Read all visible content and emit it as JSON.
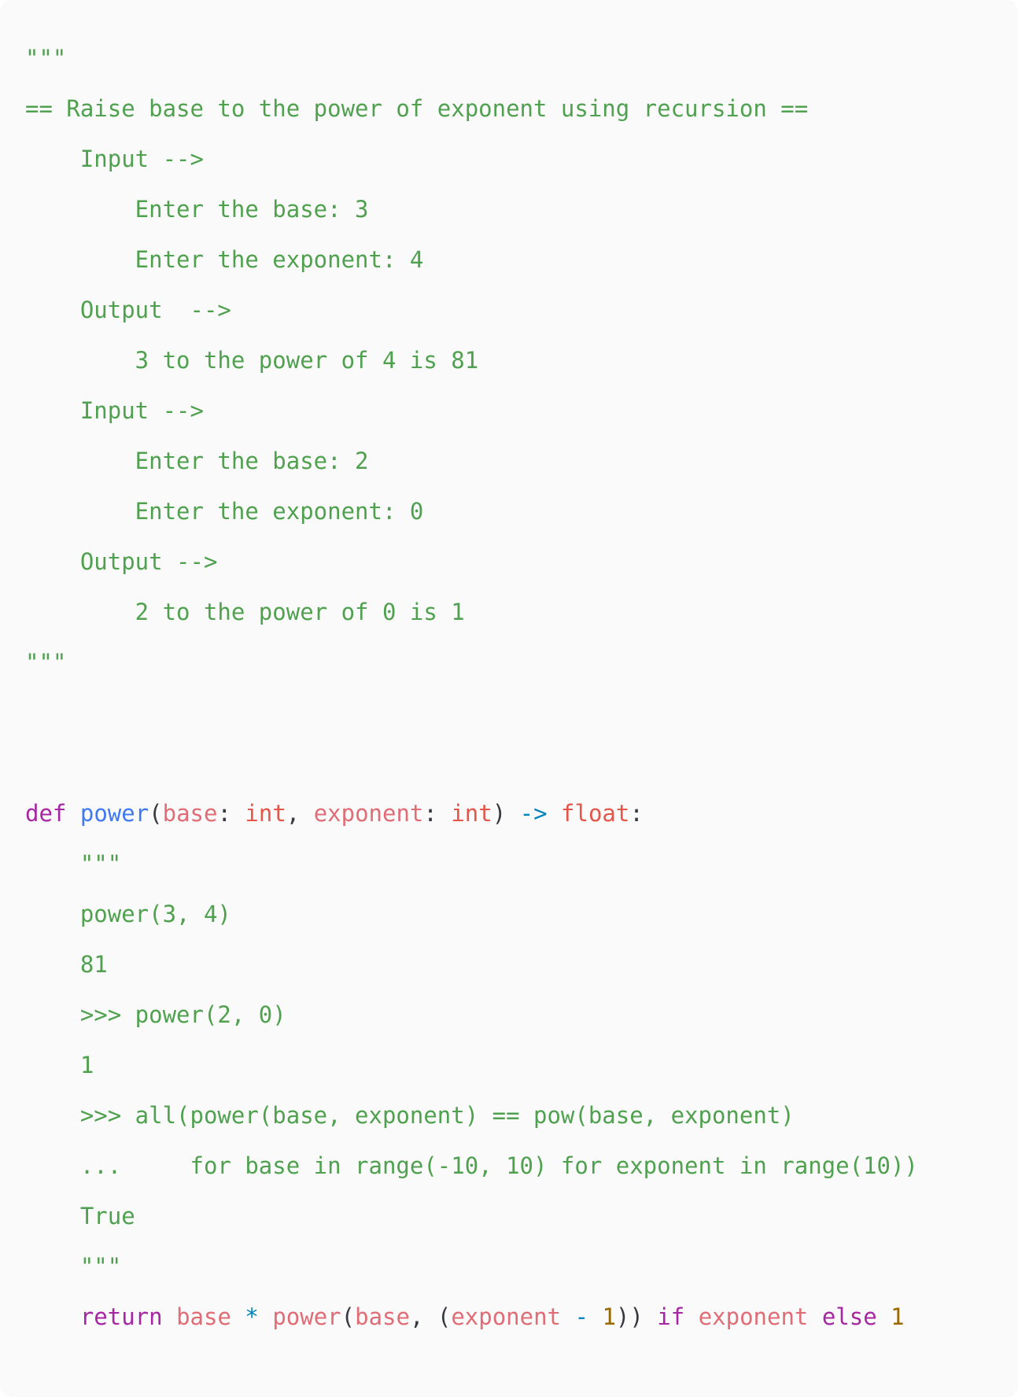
{
  "colors": {
    "background": "#fafafa",
    "string": "#50a14f",
    "keyword": "#a626a4",
    "function": "#4078f2",
    "parameter": "#e45649",
    "variable": "#e06c75",
    "operator": "#0184bc",
    "number": "#986801",
    "punctuation": "#383a42"
  },
  "code": {
    "lines": [
      {
        "tokens": [
          {
            "t": "\"\"\"",
            "k": "str"
          }
        ]
      },
      {
        "tokens": [
          {
            "t": "== Raise base to the power of exponent using recursion ==",
            "k": "str"
          }
        ]
      },
      {
        "tokens": [
          {
            "t": "    Input -->",
            "k": "str"
          }
        ]
      },
      {
        "tokens": [
          {
            "t": "        Enter the base: 3",
            "k": "str"
          }
        ]
      },
      {
        "tokens": [
          {
            "t": "        Enter the exponent: 4",
            "k": "str"
          }
        ]
      },
      {
        "tokens": [
          {
            "t": "    Output  -->",
            "k": "str"
          }
        ]
      },
      {
        "tokens": [
          {
            "t": "        3 to the power of 4 is 81",
            "k": "str"
          }
        ]
      },
      {
        "tokens": [
          {
            "t": "    Input -->",
            "k": "str"
          }
        ]
      },
      {
        "tokens": [
          {
            "t": "        Enter the base: 2",
            "k": "str"
          }
        ]
      },
      {
        "tokens": [
          {
            "t": "        Enter the exponent: 0",
            "k": "str"
          }
        ]
      },
      {
        "tokens": [
          {
            "t": "    Output -->",
            "k": "str"
          }
        ]
      },
      {
        "tokens": [
          {
            "t": "        2 to the power of 0 is 1",
            "k": "str"
          }
        ]
      },
      {
        "tokens": [
          {
            "t": "\"\"\"",
            "k": "str"
          }
        ]
      },
      {
        "tokens": []
      },
      {
        "tokens": []
      },
      {
        "tokens": [
          {
            "t": "def",
            "k": "kw"
          },
          {
            "t": " ",
            "k": "punc"
          },
          {
            "t": "power",
            "k": "fn"
          },
          {
            "t": "(",
            "k": "punc"
          },
          {
            "t": "base",
            "k": "var"
          },
          {
            "t": ": ",
            "k": "punc"
          },
          {
            "t": "int",
            "k": "type"
          },
          {
            "t": ", ",
            "k": "punc"
          },
          {
            "t": "exponent",
            "k": "var"
          },
          {
            "t": ": ",
            "k": "punc"
          },
          {
            "t": "int",
            "k": "type"
          },
          {
            "t": ") ",
            "k": "punc"
          },
          {
            "t": "->",
            "k": "op"
          },
          {
            "t": " ",
            "k": "punc"
          },
          {
            "t": "float",
            "k": "type"
          },
          {
            "t": ":",
            "k": "punc"
          }
        ]
      },
      {
        "tokens": [
          {
            "t": "    \"\"\"",
            "k": "str"
          }
        ]
      },
      {
        "tokens": [
          {
            "t": "    power(3, 4)",
            "k": "str"
          }
        ]
      },
      {
        "tokens": [
          {
            "t": "    81",
            "k": "str"
          }
        ]
      },
      {
        "tokens": [
          {
            "t": "    >>> power(2, 0)",
            "k": "str"
          }
        ]
      },
      {
        "tokens": [
          {
            "t": "    1",
            "k": "str"
          }
        ]
      },
      {
        "tokens": [
          {
            "t": "    >>> all(power(base, exponent) == pow(base, exponent)",
            "k": "str"
          }
        ]
      },
      {
        "tokens": [
          {
            "t": "    ...     for base in range(-10, 10) for exponent in range(10))",
            "k": "str"
          }
        ]
      },
      {
        "tokens": [
          {
            "t": "    True",
            "k": "str"
          }
        ]
      },
      {
        "tokens": [
          {
            "t": "    \"\"\"",
            "k": "str"
          }
        ]
      },
      {
        "tokens": [
          {
            "t": "    ",
            "k": "punc"
          },
          {
            "t": "return",
            "k": "kw"
          },
          {
            "t": " ",
            "k": "punc"
          },
          {
            "t": "base",
            "k": "var"
          },
          {
            "t": " ",
            "k": "punc"
          },
          {
            "t": "*",
            "k": "op"
          },
          {
            "t": " ",
            "k": "punc"
          },
          {
            "t": "power",
            "k": "var"
          },
          {
            "t": "(",
            "k": "punc"
          },
          {
            "t": "base",
            "k": "var"
          },
          {
            "t": ", (",
            "k": "punc"
          },
          {
            "t": "exponent",
            "k": "var"
          },
          {
            "t": " ",
            "k": "punc"
          },
          {
            "t": "-",
            "k": "op"
          },
          {
            "t": " ",
            "k": "punc"
          },
          {
            "t": "1",
            "k": "num"
          },
          {
            "t": ")) ",
            "k": "punc"
          },
          {
            "t": "if",
            "k": "kw"
          },
          {
            "t": " ",
            "k": "punc"
          },
          {
            "t": "exponent",
            "k": "var"
          },
          {
            "t": " ",
            "k": "punc"
          },
          {
            "t": "else",
            "k": "kw"
          },
          {
            "t": " ",
            "k": "punc"
          },
          {
            "t": "1",
            "k": "num"
          }
        ]
      }
    ]
  }
}
